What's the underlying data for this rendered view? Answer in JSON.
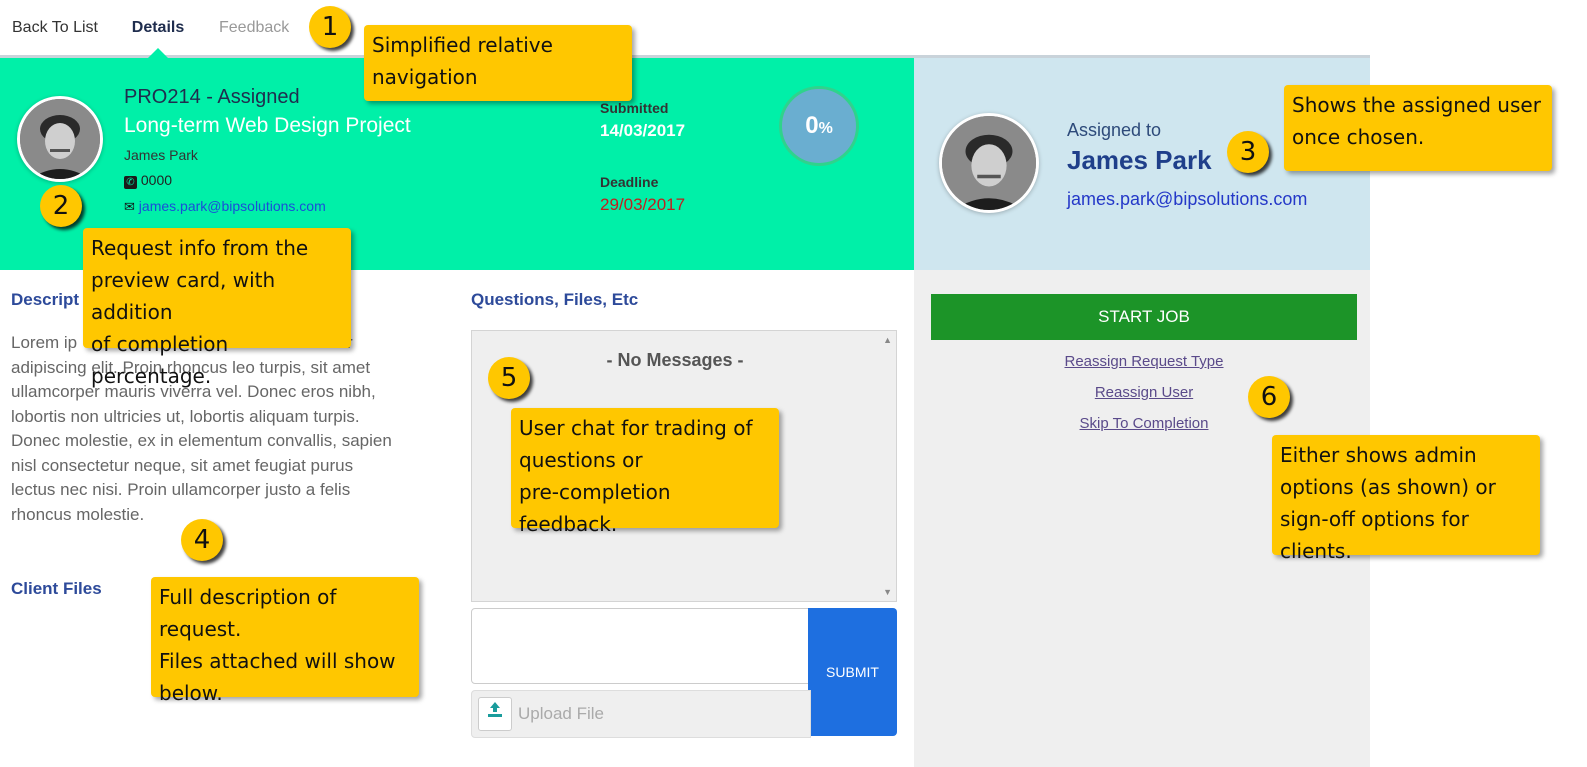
{
  "nav": {
    "back_label": "Back To List",
    "details_label": "Details",
    "feedback_label": "Feedback"
  },
  "request": {
    "code_status": "PRO214 - Assigned",
    "title": "Long-term Web Design Project",
    "requester_name": "James Park",
    "phone": "0000",
    "email": "james.park@bipsolutions.com",
    "submitted_label": "Submitted",
    "submitted_date": "14/03/2017",
    "deadline_label": "Deadline",
    "deadline_date": "29/03/2017",
    "progress_value": "0",
    "progress_unit": "%"
  },
  "assigned": {
    "label": "Assigned to",
    "name": "James Park",
    "email": "james.park@bipsolutions.com"
  },
  "description": {
    "heading": "Descript",
    "text_line1": "Lorem ip",
    "text_line1_tail": "r",
    "text_rest": [
      "adipiscing elit. Proin rhoncus leo turpis, sit amet",
      "ullamcorper mauris viverra vel. Donec eros nibh,",
      "lobortis non ultricies ut, lobortis aliquam turpis.",
      "Donec molestie, ex in elementum convallis, sapien",
      "nisl consectetur neque, sit amet feugiat purus",
      "lectus nec nisi. Proin ullamcorper justo a felis",
      "rhoncus molestie."
    ],
    "client_files_heading": "Client Files"
  },
  "messages": {
    "heading": "Questions, Files, Etc",
    "empty_text": "- No Messages -",
    "submit_label": "SUBMIT",
    "upload_placeholder": "Upload File"
  },
  "actions": {
    "start_job": "START JOB",
    "reassign_type": "Reassign Request Type",
    "reassign_user": "Reassign User",
    "skip": "Skip To Completion"
  },
  "callouts": {
    "c1_number": "1",
    "c1_text": [
      "Simplified relative",
      "navigation"
    ],
    "c2_number": "2",
    "c2_text": [
      "Request info from the",
      "preview card, with addition",
      "of completion percentage."
    ],
    "c3_number": "3",
    "c3_text": [
      "Shows the assigned user",
      "once chosen."
    ],
    "c4_number": "4",
    "c4_text": [
      "Full description of request.",
      "Files attached will show",
      "below."
    ],
    "c5_number": "5",
    "c5_text": [
      "User chat for trading of",
      "questions or",
      "pre-completion feedback."
    ],
    "c6_number": "6",
    "c6_text": [
      "Either shows admin",
      "options (as shown) or",
      "sign-off options for clients."
    ]
  },
  "colors": {
    "header_green": "#00f0a8",
    "assigned_panel": "#cfe6ef",
    "start_job": "#1c9428",
    "submit": "#1e6fe0",
    "callout": "#ffc700",
    "deadline": "#c02020"
  }
}
